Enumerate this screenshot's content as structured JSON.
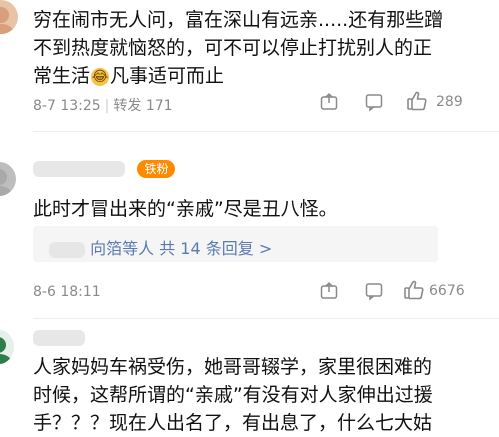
{
  "comment1": {
    "text_line1": "穷在闹市无人问，富在深山有远亲.....还有那些蹭",
    "text_line2": "不到热度就恼怒的，可不可以停止打扰别人的正",
    "text_line3_before": "常生活",
    "text_line3_after": "凡事适可而止",
    "emoji_icon": "face-with-tears-of-joy-icon",
    "date": "8-7 13:25",
    "repost_label": "转发 171",
    "like_count": "289"
  },
  "comment2": {
    "badge": "铁粉",
    "text": "此时才冒出来的“亲戚”尽是丑八怪。",
    "reply_users_suffix": "向箔等人",
    "reply_count_label": "共 14 条回复",
    "reply_chevron": ">",
    "date": "8-6 18:11",
    "like_count": "6676"
  },
  "comment3": {
    "text_line1": "人家妈妈车祸受伤，她哥哥辍学，家里很困难的",
    "text_line2": "时候，这帮所谓的“亲戚”有没有对人家伸出过援",
    "text_line3": "手？？？现在人出名了，有出息了，什么七大姑"
  },
  "colors": {
    "meta_gray": "#8a8a8a",
    "reply_blue": "#5a7bb2",
    "badge_orange": "#ff8a00",
    "reply_bg": "#f5f5f5"
  },
  "icons": [
    "share-icon",
    "comment-icon",
    "like-icon"
  ]
}
